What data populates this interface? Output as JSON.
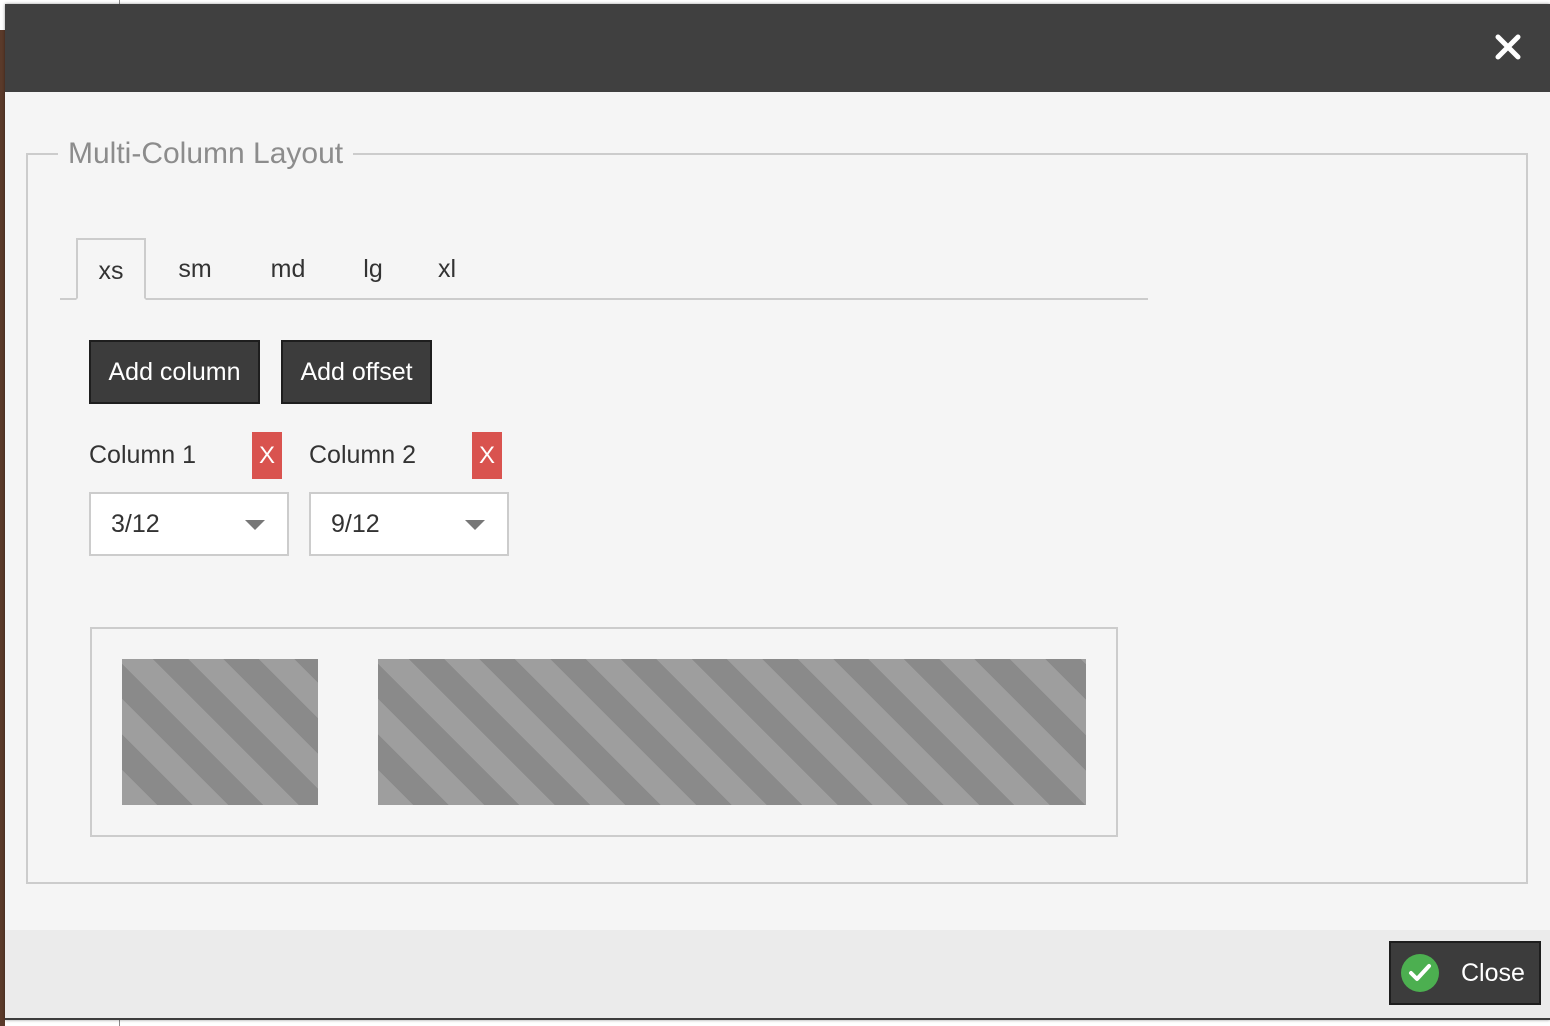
{
  "dialog": {
    "close_icon": "close-icon",
    "title_bar_color": "#404040"
  },
  "fieldset": {
    "legend": "Multi-Column Layout"
  },
  "tabs": [
    {
      "label": "xs",
      "active": true
    },
    {
      "label": "sm",
      "active": false
    },
    {
      "label": "md",
      "active": false
    },
    {
      "label": "lg",
      "active": false
    },
    {
      "label": "xl",
      "active": false
    }
  ],
  "toolbar": {
    "add_column_label": "Add column",
    "add_offset_label": "Add offset"
  },
  "columns": [
    {
      "label": "Column 1",
      "remove_label": "X",
      "width_value": "3/12",
      "width_fraction": 0.25
    },
    {
      "label": "Column 2",
      "remove_label": "X",
      "width_value": "9/12",
      "width_fraction": 0.75
    }
  ],
  "footer": {
    "close_label": "Close",
    "close_icon": "check-icon"
  },
  "colors": {
    "remove_button": "#d9534f",
    "check_circle": "#4caf50",
    "dark_button": "#3c3c3c"
  }
}
